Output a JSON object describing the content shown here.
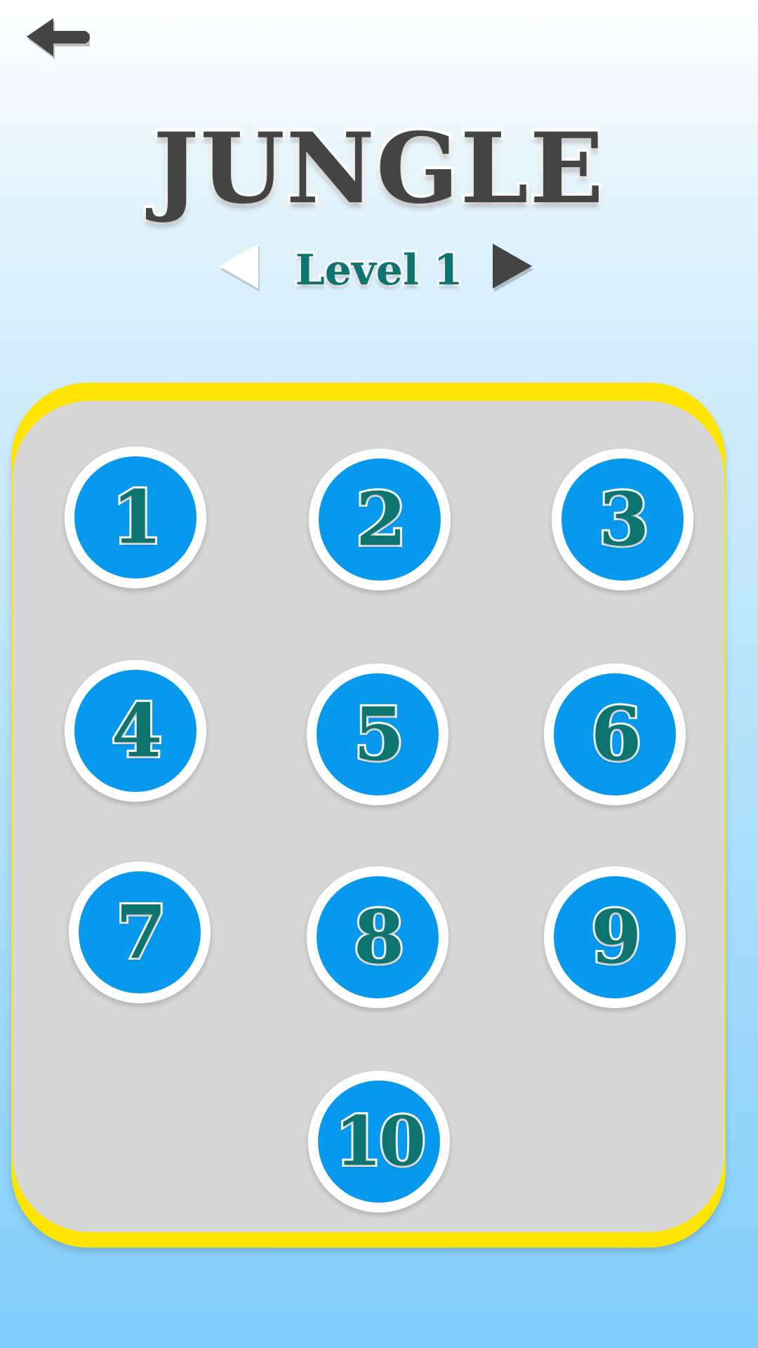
{
  "header": {
    "back_icon": "arrow-left-icon",
    "title": "JUNGLE"
  },
  "level_selector": {
    "label": "Level 1",
    "prev_icon": "triangle-left-icon",
    "next_icon": "triangle-right-icon",
    "prev_color": "#ffffff",
    "next_color": "#444444"
  },
  "grid": {
    "levels": [
      "1",
      "2",
      "3",
      "4",
      "5",
      "6",
      "7",
      "8",
      "9",
      "10"
    ]
  },
  "colors": {
    "title": "#444444",
    "level_number": "#0d7470",
    "button_fill": "#0799ee",
    "panel": "#d7d7d7",
    "panel_border": "#ffe400"
  }
}
